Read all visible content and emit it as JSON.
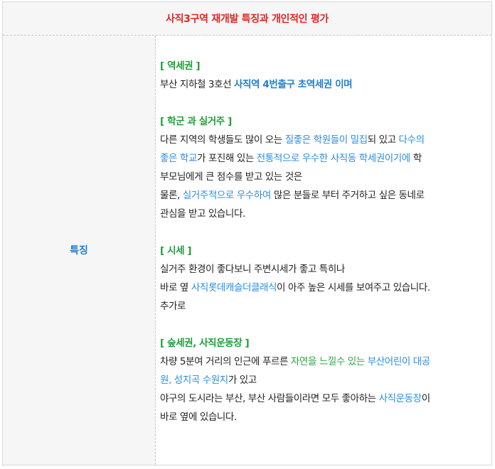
{
  "header": {
    "title": "사직3구역 재개발 특징과 개인적인 평가"
  },
  "label": {
    "text": "특징"
  },
  "sections": {
    "station": {
      "head": "[ 역세권 ]",
      "l1_a": "부산 지하철 3호선 ",
      "l1_b": "사직역 4번출구 초역세권 이며"
    },
    "school": {
      "head": "[ 학군 과 실거주 ]",
      "l1_a": "다른 지역의 학생들도 많이 오는 ",
      "l1_b": "질좋은 학원들이 밀집",
      "l1_c": "되 있고 ",
      "l1_d": "다수의",
      "l2_a": "좋은 학교",
      "l2_b": "가 포진해 있는 ",
      "l2_c": "전통적으로 우수한 사직동 학세권이기에",
      "l2_d": " 학",
      "l3": "부모님에게 큰 점수를 받고 있는 것은",
      "l4_a": "물론, ",
      "l4_b": "실거주적으로 우수하여",
      "l4_c": " 많은 분들로 부터 주거하고 싶은 동네로",
      "l5": "관심을 받고 있습니다."
    },
    "price": {
      "head": "[ 시세 ]",
      "l1": "실거주 환경이 좋다보니 주변시세가 좋고 특히나",
      "l2_a": "바로 옆 ",
      "l2_b": "사직롯데캐슬더클래식",
      "l2_c": "이 아주 높은 시세를 보여주고 있습니다.",
      "l3": "추가로"
    },
    "forest": {
      "head": "[ 숲세권, 사직운동장 ]",
      "l1_a": "차량 5분여 거리의 인근에 푸르른 ",
      "l1_b": "자연을 느낄수 있는",
      "l1_c": " ",
      "l1_d": "부산어린이 대공",
      "l2_a": "원, 성지곡 수원지",
      "l2_b": "가 있고",
      "l3_a": "야구의 도시라는 부산, 부산 사람들이라면 모두 좋아하는 ",
      "l3_b": "사직운동장",
      "l3_c": "이",
      "l4": "바로 옆에 있습니다."
    }
  },
  "colors": {
    "title_red": "#e0271f",
    "label_blue": "#1f7fcf",
    "link_blue": "#2a8de0",
    "head_green": "#1f9e3a",
    "text_green": "#2aa745"
  }
}
